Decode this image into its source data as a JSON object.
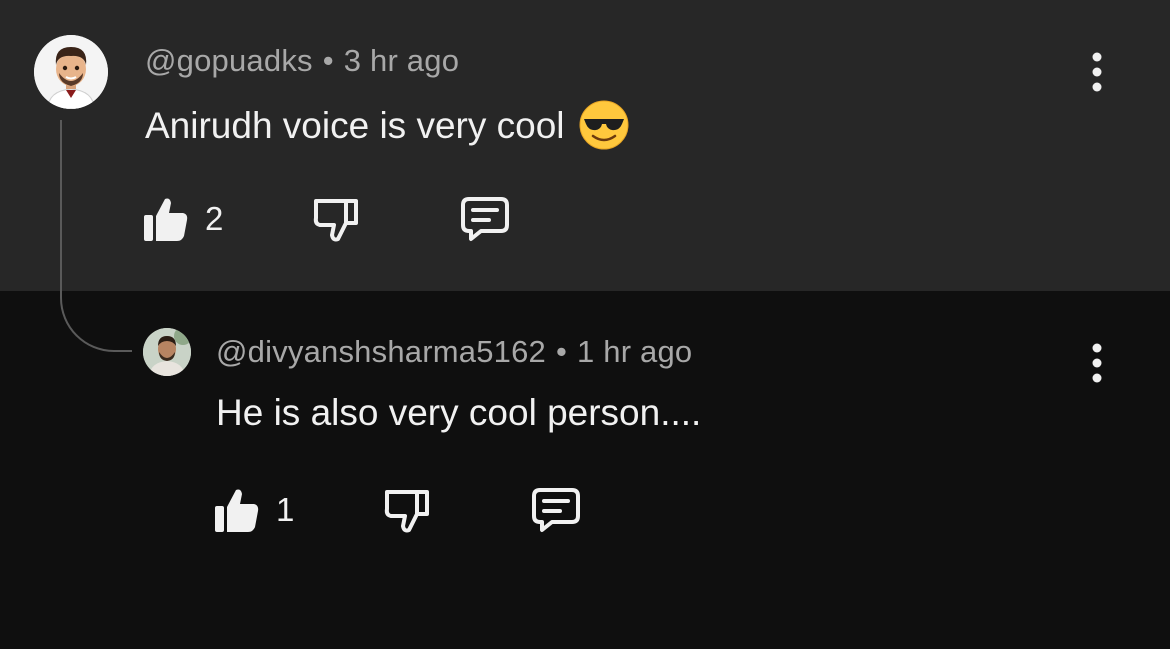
{
  "comment": {
    "author": "@gopuadks",
    "separator": "•",
    "time": "3 hr ago",
    "text": "Anirudh voice is very cool",
    "emoji": "smiling-face-with-sunglasses",
    "likes": "2"
  },
  "reply": {
    "author": "@divyanshsharma5162",
    "separator": "•",
    "time": "1 hr ago",
    "text": "He is also very cool person....",
    "likes": "1"
  },
  "icons": {
    "like": "thumbs-up-icon",
    "dislike": "thumbs-down-icon",
    "reply": "comment-icon",
    "more": "more-vertical-icon"
  },
  "colors": {
    "background": "#0f0f0f",
    "highlight": "#272727",
    "text": "#f1f1f1",
    "secondary": "#a8a8a8"
  }
}
